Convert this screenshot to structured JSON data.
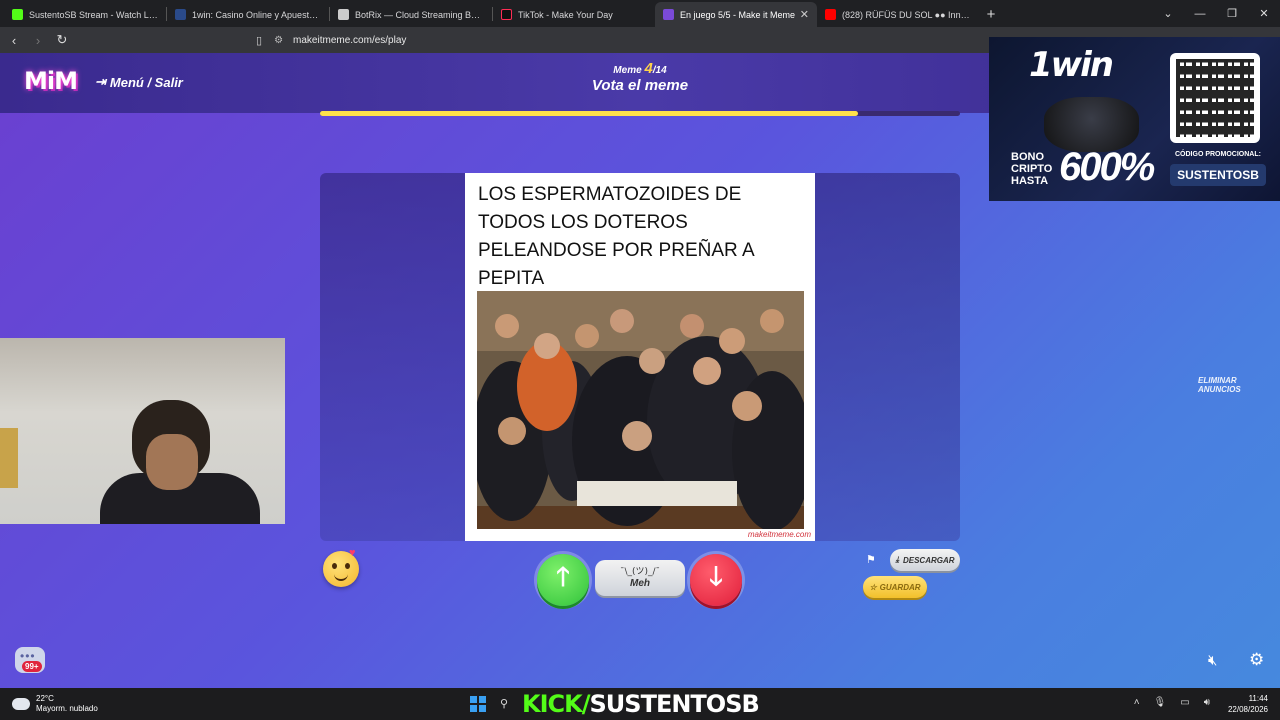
{
  "browser": {
    "tabs": [
      {
        "title": "SustentoSB Stream - Watch Live ...",
        "color": "#53fc18",
        "active": false
      },
      {
        "title": "1win: Casino Online y Apuestas Depo...",
        "color": "#2a4a8a",
        "active": false
      },
      {
        "title": "BotRix — Cloud Streaming Bot for Tw...",
        "color": "#cccccc",
        "active": false
      },
      {
        "title": "TikTok - Make Your Day",
        "color": "#111111",
        "active": false
      },
      {
        "title": "En juego 5/5 - Make it Meme",
        "color": "#7a4ad8",
        "active": true
      },
      {
        "title": "(828) RÜFÜS DU SOL ●● Innerbloom",
        "color": "#ff0000",
        "active": false
      }
    ],
    "new_tab": "+",
    "url": "makeitmeme.com/es/play"
  },
  "header": {
    "logo": "MiM",
    "menu_label": "Menú / Salir",
    "meme_prefix": "Meme",
    "meme_current": "4",
    "meme_total": "/14",
    "title": "Vota el meme",
    "progress": 0.84
  },
  "meme": {
    "caption": "LOS ESPERMATOZOIDES DE TODOS LOS DOTEROS PELEANDOSE POR PREÑAR A PEPITA",
    "watermark": "makeitmeme.com"
  },
  "votes": {
    "up_icon": "arrow-up-icon",
    "down_icon": "arrow-down-icon",
    "meh_face": "¯\\_(ツ)_/¯",
    "meh_label": "Meh"
  },
  "actions": {
    "download": "DESCARGAR",
    "save": "GUARDAR",
    "remove_ads": "ELIMINAR ANUNCIOS"
  },
  "chat": {
    "badge": "99+"
  },
  "ad": {
    "logo": "1win",
    "bono": "BONO",
    "cripto": "CRIPTO",
    "hasta": "HASTA",
    "percent": "600%",
    "code_label": "CÓDIGO PROMOCIONAL:",
    "code": "SUSTENTOSB"
  },
  "taskbar": {
    "temperature": "22°C",
    "weather": "Mayorm. nublado",
    "banner_kick": "KICK/",
    "banner_name": "SUSTENTOSB",
    "time": "11:44",
    "date": "22/08/2026"
  }
}
